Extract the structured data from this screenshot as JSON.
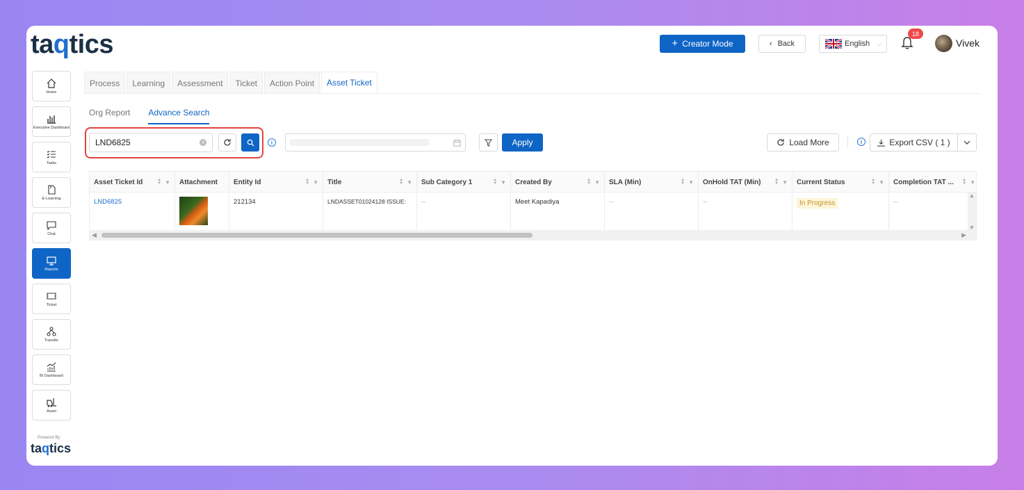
{
  "header": {
    "logo_pre": "ta",
    "logo_q": "q",
    "logo_post": "tics",
    "creator_mode": "Creator Mode",
    "back": "Back",
    "language": "English",
    "notification_count": "18",
    "username": "Vivek"
  },
  "sidebar": {
    "items": [
      {
        "label": "Home"
      },
      {
        "label": "Executive Dashboard"
      },
      {
        "label": "Tasks"
      },
      {
        "label": "E-Learning"
      },
      {
        "label": "Chat"
      },
      {
        "label": "Reports"
      },
      {
        "label": "Ticket"
      },
      {
        "label": "Transfer"
      },
      {
        "label": "BI Dashboard"
      },
      {
        "label": "Asset"
      }
    ],
    "powered_by": "Powered By"
  },
  "tabs": [
    "Process",
    "Learning",
    "Assessment",
    "Ticket",
    "Action Point",
    "Asset Ticket"
  ],
  "subtabs": [
    "Org Report",
    "Advance Search"
  ],
  "search": {
    "value": "LND6825"
  },
  "toolbar": {
    "apply": "Apply",
    "load_more": "Load More",
    "export": "Export CSV ( 1 )"
  },
  "table": {
    "columns": [
      "Asset Ticket Id",
      "Attachment",
      "Entity Id",
      "Title",
      "Sub Category 1",
      "Created By",
      "SLA (Min)",
      "OnHold TAT (Min)",
      "Current Status",
      "Completion TAT ..."
    ],
    "row": {
      "asset_ticket_id": "LND6825",
      "entity_id": "212134",
      "title": "LNDASSET01024128 ISSUE:",
      "sub_category": "--",
      "created_by": "Meet Kapadiya",
      "sla": "--",
      "onhold_tat": "--",
      "current_status": "In Progress",
      "completion_tat": "--"
    }
  },
  "colors": {
    "primary": "#0f65c5",
    "highlight_border": "#e2443f",
    "status_bg": "#fdf5d8",
    "status_text": "#c8932b"
  }
}
